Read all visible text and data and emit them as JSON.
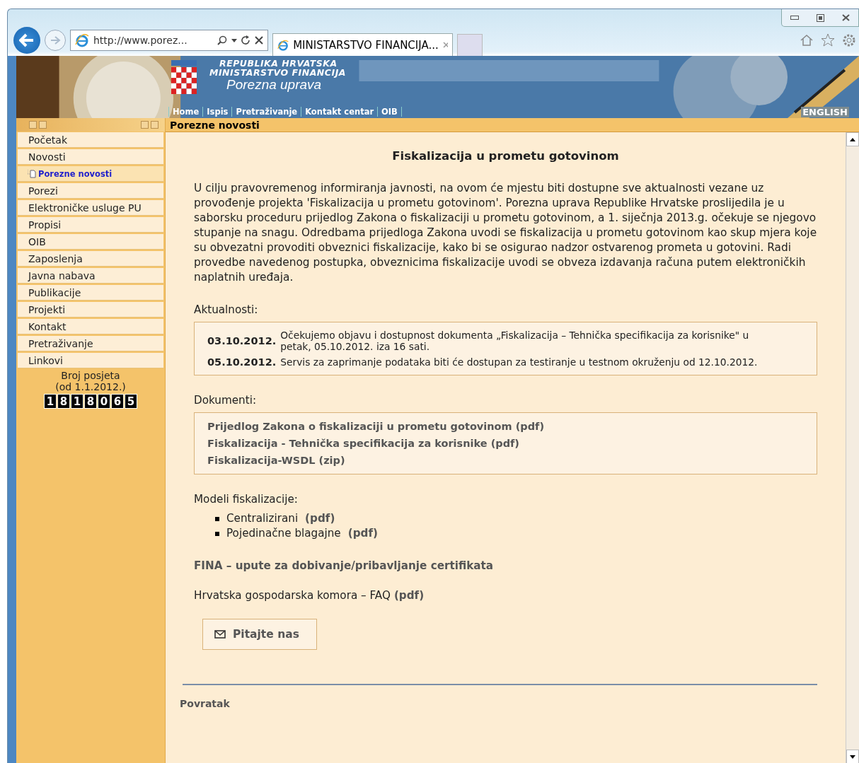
{
  "browser": {
    "address": "http://www.porez...",
    "tab_title": "MINISTARSTVO FINANCIJA..."
  },
  "header": {
    "lines": [
      "REPUBLIKA HRVATSKA",
      "MINISTARSTVO FINANCIJA"
    ],
    "subtitle": "Porezna uprava",
    "nav": [
      "Home",
      "Ispis",
      "Pretraživanje",
      "Kontakt centar",
      "OIB"
    ],
    "language": "ENGLISH"
  },
  "breadcrumb": "Porezne novosti",
  "sidebar": {
    "items": [
      {
        "label": "Početak",
        "selected": false
      },
      {
        "label": "Novosti",
        "selected": false,
        "children": [
          {
            "label": "Porezne novosti",
            "selected": true
          }
        ]
      },
      {
        "label": "Porezi",
        "selected": false
      },
      {
        "label": "Elektroničke usluge PU",
        "selected": false
      },
      {
        "label": "Propisi",
        "selected": false
      },
      {
        "label": "OIB",
        "selected": false
      },
      {
        "label": "Zaposlenja",
        "selected": false
      },
      {
        "label": "Javna nabava",
        "selected": false
      },
      {
        "label": "Publikacije",
        "selected": false
      },
      {
        "label": "Projekti",
        "selected": false
      },
      {
        "label": "Kontakt",
        "selected": false
      },
      {
        "label": "Pretraživanje",
        "selected": false
      },
      {
        "label": "Linkovi",
        "selected": false
      }
    ],
    "counter": {
      "label": "Broj posjeta",
      "since": "(od 1.1.2012.)",
      "digits": [
        "1",
        "8",
        "1",
        "8",
        "0",
        "6",
        "5"
      ]
    }
  },
  "article": {
    "title": "Fiskalizacija u prometu gotovinom",
    "intro": "U cilju pravovremenog informiranja javnosti, na ovom će mjestu biti dostupne sve aktualnosti vezane uz provođenje projekta 'Fiskalizacija u prometu gotovinom'. Porezna uprava Republike Hrvatske proslijedila je u saborsku proceduru prijedlog Zakona o fiskalizaciji u prometu gotovinom, a 1. siječnja 2013.g. očekuje se njegovo stupanje na snagu. Odredbama prijedloga Zakona uvodi se fiskalizacija u prometu gotovinom kao skup mjera koje su obvezatni provoditi obveznici fiskalizacije, kako bi se osigurao nadzor ostvarenog prometa u gotovini. Radi provedbe navedenog postupka, obveznicima fiskalizacije uvodi se obveza izdavanja računa putem elektroničkih naplatnih uređaja.",
    "news_heading": "Aktualnosti:",
    "news": [
      {
        "date": "03.10.2012.",
        "text": "Očekujemo objavu i dostupnost dokumenta „Fiskalizacija – Tehnička specifikacija za korisnike\" u petak, 05.10.2012. iza 16 sati."
      },
      {
        "date": "05.10.2012.",
        "text": "Servis za zaprimanje podataka biti će dostupan za testiranje u testnom okruženju od 12.10.2012."
      }
    ],
    "documents_heading": "Dokumenti:",
    "documents": [
      "Prijedlog Zakona o fiskalizaciji u prometu gotovinom (pdf)",
      "Fiskalizacija - Tehnička specifikacija za korisnike (pdf)",
      "Fiskalizacija-WSDL (zip)"
    ],
    "models_heading": "Modeli fiskalizacije:",
    "models": [
      {
        "text": "Centralizirani",
        "link": "(pdf)"
      },
      {
        "text": "Pojedinačne blagajne",
        "link": "(pdf)"
      }
    ],
    "fina_link": "FINA – upute za dobivanje/pribavljanje certifikata",
    "hgk": {
      "text": "Hrvatska gospodarska komora – FAQ",
      "link": "(pdf)"
    },
    "ask_button": "Pitajte nas",
    "back_link": "Povratak"
  }
}
